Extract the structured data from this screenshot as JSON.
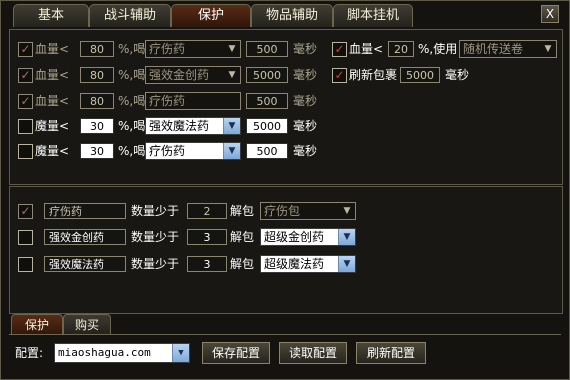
{
  "tabs": [
    "基本",
    "战斗辅助",
    "保护",
    "物品辅助",
    "脚本挂机"
  ],
  "close_label": "X",
  "hp_rows": [
    {
      "checked": true,
      "label": "血量<",
      "value": "80",
      "suffix": "%,喝",
      "item": "疗伤药",
      "ms": "500",
      "unit": "毫秒",
      "enabled": false
    },
    {
      "checked": true,
      "label": "血量<",
      "value": "80",
      "suffix": "%,喝",
      "item": "强效金创药",
      "ms": "5000",
      "unit": "毫秒",
      "enabled": false
    },
    {
      "checked": true,
      "label": "血量<",
      "value": "80",
      "suffix": "%,喝",
      "item": "疗伤药",
      "ms": "500",
      "unit": "毫秒",
      "enabled": false
    },
    {
      "checked": false,
      "label": "魔量<",
      "value": "30",
      "suffix": "%,喝",
      "item": "强效魔法药",
      "ms": "5000",
      "unit": "毫秒",
      "enabled": true
    },
    {
      "checked": false,
      "label": "魔量<",
      "value": "30",
      "suffix": "%,喝",
      "item": "疗伤药",
      "ms": "500",
      "unit": "毫秒",
      "enabled": true
    }
  ],
  "teleport": {
    "checked": true,
    "label": "血量<",
    "value": "20",
    "suffix": "%,使用",
    "item": "随机传送卷"
  },
  "refresh_bag": {
    "checked": true,
    "label": "刷新包裹",
    "ms": "5000",
    "unit": "毫秒"
  },
  "unpack_rows": [
    {
      "checked": true,
      "item": "疗伤药",
      "qty_label": "数量少于",
      "qty": "2",
      "unpack_label": "解包",
      "bundle": "疗伤包",
      "enabled": false
    },
    {
      "checked": false,
      "item": "强效金创药",
      "qty_label": "数量少于",
      "qty": "3",
      "unpack_label": "解包",
      "bundle": "超级金创药",
      "enabled": true
    },
    {
      "checked": false,
      "item": "强效魔法药",
      "qty_label": "数量少于",
      "qty": "3",
      "unpack_label": "解包",
      "bundle": "超级魔法药",
      "enabled": true
    }
  ],
  "bottom_tabs": [
    "保护",
    "购买"
  ],
  "config": {
    "label": "配置:",
    "value": "miaoshagua.com"
  },
  "buttons": {
    "save": "保存配置",
    "load": "读取配置",
    "refresh": "刷新配置"
  }
}
